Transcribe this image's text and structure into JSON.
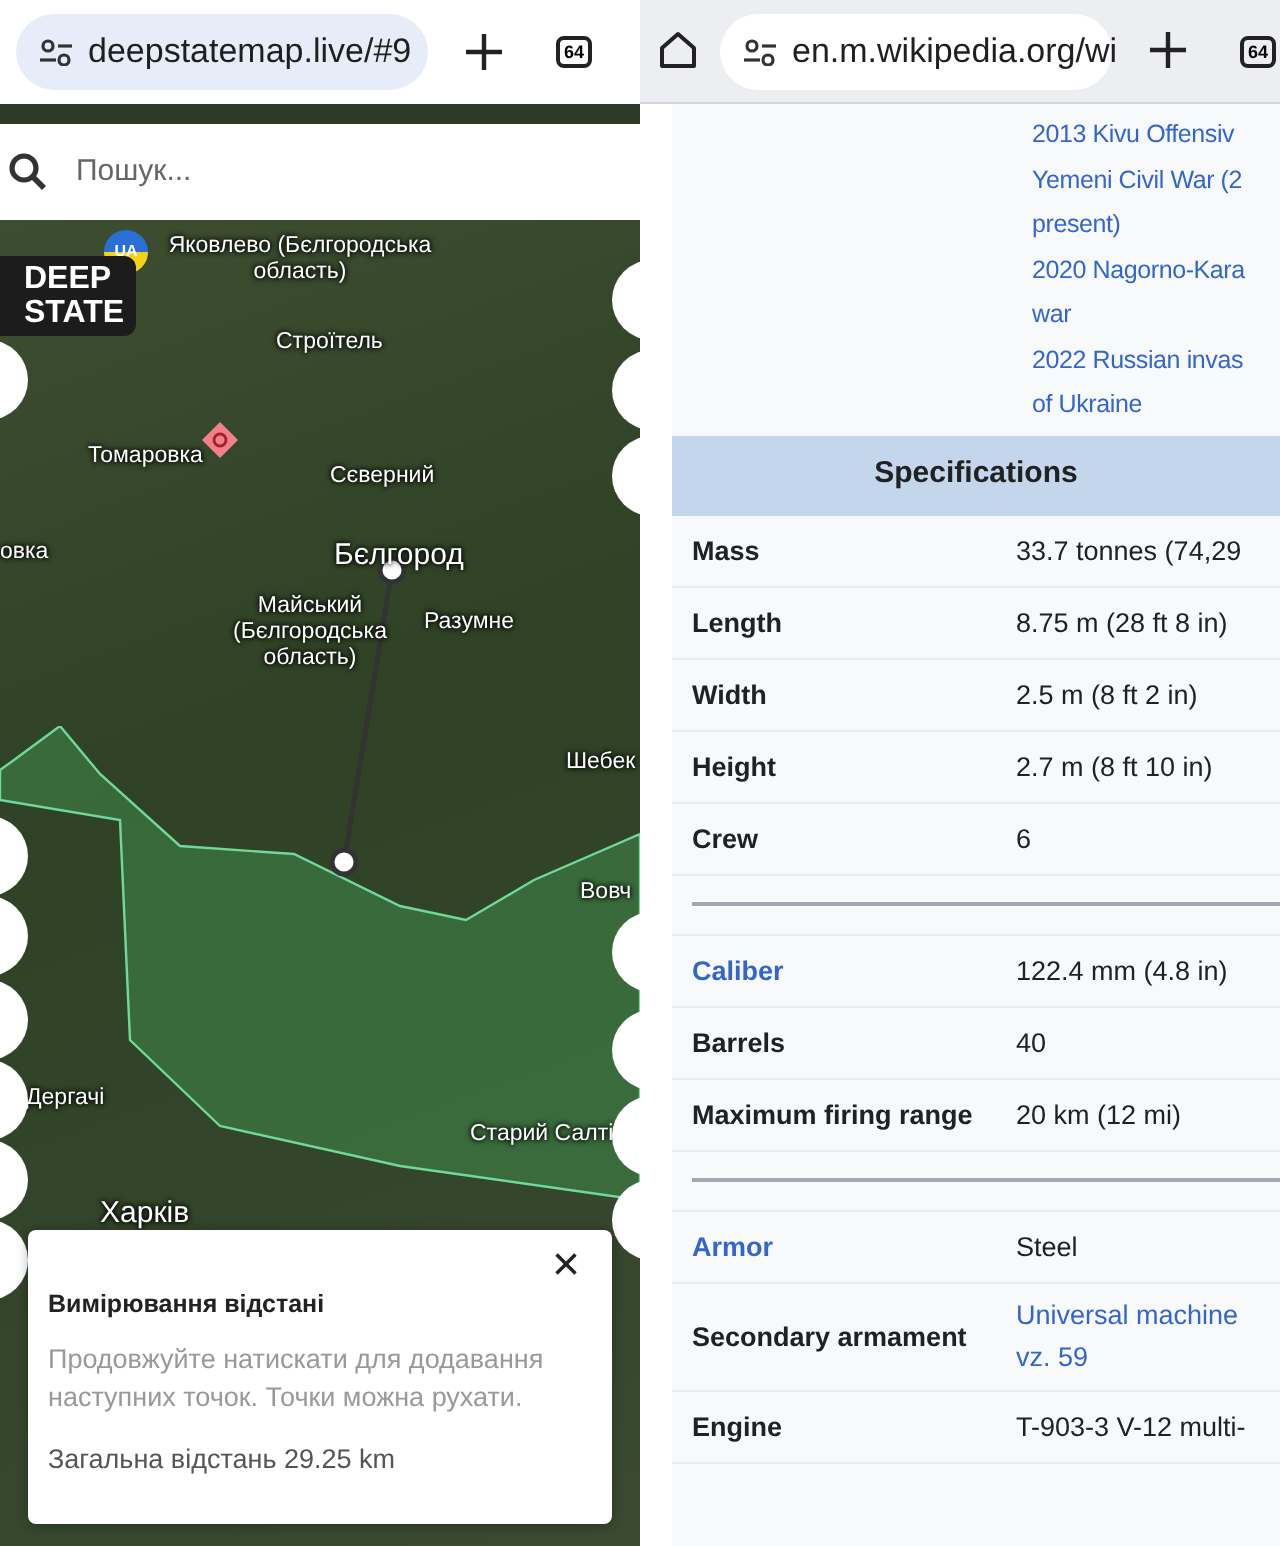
{
  "left_browser": {
    "url": "deepstatemap.live/#9",
    "tab_count": "64"
  },
  "map_search": {
    "placeholder": "Пошук..."
  },
  "map": {
    "logo": [
      "DEEP",
      "STATE"
    ],
    "badge": "UA",
    "places": [
      {
        "name": "Яковлево (Бєлгородська область)",
        "kind": "village"
      },
      {
        "name": "Строїтель",
        "kind": "village"
      },
      {
        "name": "Томаровка",
        "kind": "village"
      },
      {
        "name": "Сєверний",
        "kind": "village"
      },
      {
        "name": "овка",
        "kind": "village"
      },
      {
        "name": "Бєлгород",
        "kind": "city"
      },
      {
        "name": "Майський (Бєлгородська область)",
        "kind": "village"
      },
      {
        "name": "Разумне",
        "kind": "village"
      },
      {
        "name": "Шебек",
        "kind": "village"
      },
      {
        "name": "Вовч",
        "kind": "village"
      },
      {
        "name": "Дергачі",
        "kind": "village"
      },
      {
        "name": "Старий Салті",
        "kind": "village"
      },
      {
        "name": "Харків",
        "kind": "city"
      }
    ]
  },
  "measure_popup": {
    "title": "Вимірювання відстані",
    "description": "Продовжуйте натискати для додавання наступних точок. Точки можна рухати.",
    "total": "Загальна відстань 29.25 km",
    "close": "×"
  },
  "right_browser": {
    "url": "en.m.wikipedia.org/wi",
    "tab_count": "64"
  },
  "infobox": {
    "wars": [
      "2013 Kivu Offensiv",
      "Yemeni Civil War (2",
      "present)",
      "2020 Nagorno-Kara",
      "war",
      "2022 Russian invas",
      "of Ukraine"
    ],
    "header": "Specifications",
    "rows": [
      {
        "kind": "row",
        "label": "Mass",
        "label_link": false,
        "value": "33.7 tonnes (74,29",
        "value_link": false
      },
      {
        "kind": "row",
        "label": "Length",
        "label_link": false,
        "value": "8.75 m (28 ft 8 in)",
        "value_link": false
      },
      {
        "kind": "row",
        "label": "Width",
        "label_link": false,
        "value": "2.5 m (8 ft 2 in)",
        "value_link": false
      },
      {
        "kind": "row",
        "label": "Height",
        "label_link": false,
        "value": "2.7 m (8 ft 10 in)",
        "value_link": false
      },
      {
        "kind": "row",
        "label": "Crew",
        "label_link": false,
        "value": "6",
        "value_link": false
      },
      {
        "kind": "divider"
      },
      {
        "kind": "row",
        "label": "Caliber",
        "label_link": true,
        "value": "122.4 mm (4.8 in)",
        "value_link": false
      },
      {
        "kind": "row",
        "label": "Barrels",
        "label_link": false,
        "value": "40",
        "value_link": false
      },
      {
        "kind": "row",
        "label": "Maximum firing range",
        "label_link": false,
        "value": "20 km (12 mi)",
        "value_link": false
      },
      {
        "kind": "divider"
      },
      {
        "kind": "row",
        "label": "Armor",
        "label_link": true,
        "value": "Steel",
        "value_link": false
      },
      {
        "kind": "row",
        "label": "Secondary armament",
        "label_link": false,
        "value": "Universal machine vz. 59",
        "value_link": true
      },
      {
        "kind": "row",
        "label": "Engine",
        "label_link": false,
        "value": "T-903-3 V-12 multi-",
        "value_link": false
      }
    ]
  }
}
